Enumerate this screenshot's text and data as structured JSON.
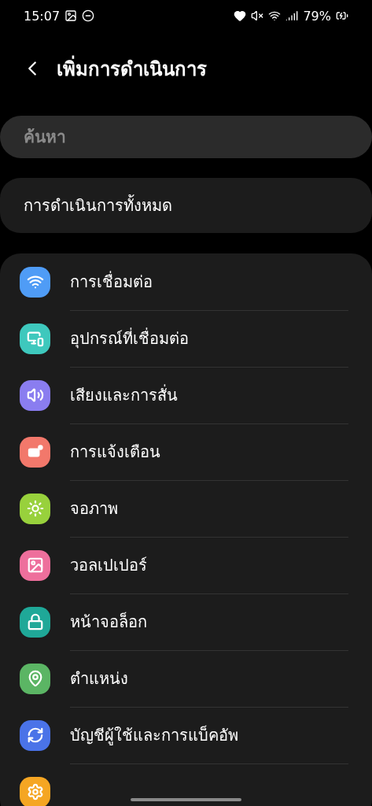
{
  "status_bar": {
    "time": "15:07",
    "battery": "79%"
  },
  "header": {
    "title": "เพิ่มการดำเนินการ"
  },
  "search": {
    "placeholder": "ค้นหา"
  },
  "all_actions": {
    "label": "การดำเนินการทั้งหมด"
  },
  "items": [
    {
      "label": "การเชื่อมต่อ",
      "color": "#4f9cf6"
    },
    {
      "label": "อุปกรณ์ที่เชื่อมต่อ",
      "color": "#3ec8bd"
    },
    {
      "label": "เสียงและการสั่น",
      "color": "#8a7df0"
    },
    {
      "label": "การแจ้งเตือน",
      "color": "#f2786b"
    },
    {
      "label": "จอภาพ",
      "color": "#98d13c"
    },
    {
      "label": "วอลเปเปอร์",
      "color": "#ee6f9c"
    },
    {
      "label": "หน้าจอล็อก",
      "color": "#1fa898"
    },
    {
      "label": "ตำแหน่ง",
      "color": "#5bb564"
    },
    {
      "label": "บัญชีผู้ใช้และการแบ็คอัพ",
      "color": "#4a73e8"
    },
    {
      "color": "#f5a623"
    }
  ]
}
